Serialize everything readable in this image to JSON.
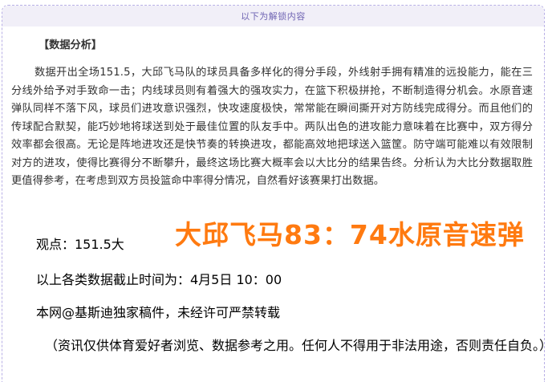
{
  "banner": {
    "label": "以下为解锁内容"
  },
  "article": {
    "heading": "【数据分析】",
    "paragraph": "数据开出全场151.5，大邱飞马队的球员具备多样化的得分手段，外线射手拥有精准的远投能力，能在三分线外给予对手致命一击；内线球员则有着强大的强攻实力，在篮下积极拼抢，不断制造得分机会。水原音速弹队同样不落下风，球员们进攻意识强烈，快攻速度极快，常常能在瞬间撕开对方防线完成得分。而且他们的传球配合默契，能巧妙地将球送到处于最佳位置的队友手中。两队出色的进攻能力意味着在比赛中，双方得分效率都会很高。无论是阵地进攻还是快节奏的转换进攻，都能高效地把球送入篮筐。防守端可能难以有效限制对方的进攻，使得比赛得分不断攀升，最终这场比赛大概率会以大比分的结果告终。分析认为大比分数据取胜更值得参考，在考虑到双方员投篮命中率得分情况，自然看好该赛果打出数据。",
    "viewpoint": "观点：151.5大",
    "cutoff": "以上各类数据截止时间为：4月5日 10：00",
    "copyright": "本网@基斯迪独家稿件，未经许可严禁转载",
    "disclaimer": "（资讯仅供体育爱好者浏览、数据参考之用。任何人不得用于非法用途，否则责任自负。）"
  },
  "score_overlay": {
    "text": "大邱飞马83：74水原音速弹",
    "color": "#ff7a10"
  },
  "colors": {
    "banner_bg": "#f1eff8",
    "banner_text": "#6f64b3",
    "frame_border": "#b9b0e6",
    "body_text": "#333333"
  }
}
